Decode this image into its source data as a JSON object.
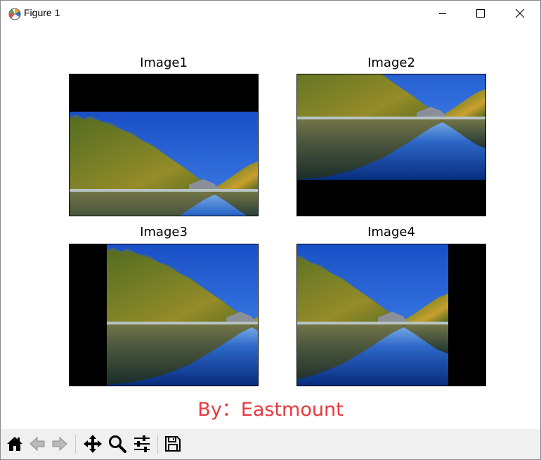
{
  "window": {
    "title": "Figure 1",
    "app_icon": "matplotlib-logo-icon",
    "controls": [
      "minimize-icon",
      "maximize-icon",
      "close-icon"
    ]
  },
  "subplots": [
    {
      "title": "Image1",
      "image": "lake landscape shifted down (black band on top)"
    },
    {
      "title": "Image2",
      "image": "lake landscape shifted up (black band on bottom)"
    },
    {
      "title": "Image3",
      "image": "lake landscape shifted right (black band on left)"
    },
    {
      "title": "Image4",
      "image": "lake landscape shifted left (black band on right)"
    }
  ],
  "footer": {
    "text": "By：Eastmount",
    "color": "#e8383d"
  },
  "toolbar": {
    "buttons": [
      "home-icon",
      "back-icon",
      "forward-icon",
      "pan-icon",
      "zoom-icon",
      "configure-subplots-icon",
      "save-icon"
    ]
  }
}
